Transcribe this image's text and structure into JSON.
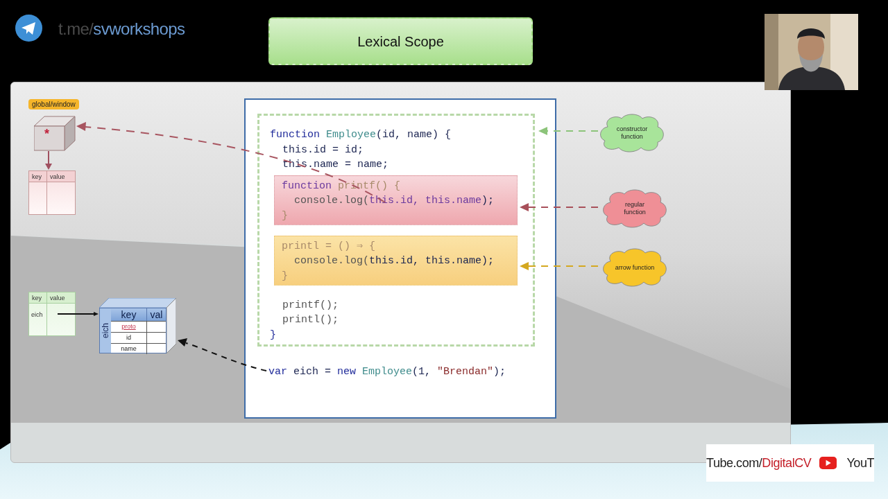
{
  "channel_link": {
    "prefix": "t.me/",
    "handle": "svworkshops"
  },
  "title": "Lexical Scope",
  "global_object": {
    "label": "global/window",
    "symbol": "*",
    "headers": [
      "key",
      "value"
    ]
  },
  "variable_table": {
    "headers": [
      "key",
      "value"
    ],
    "rows": [
      {
        "key": "eich"
      }
    ]
  },
  "object_table": {
    "name": "eich",
    "headers": [
      "key",
      "val"
    ],
    "keys": [
      "proto",
      "id",
      "name"
    ]
  },
  "code": {
    "constructor_lines": [
      [
        {
          "text": "function ",
          "kind": "keyword"
        },
        {
          "text": "Employee",
          "kind": "type"
        },
        {
          "text": "(id, name) {",
          "kind": "plain"
        }
      ],
      [
        {
          "text": "  this.id = id;",
          "kind": "plain"
        }
      ],
      [
        {
          "text": "  this.name = name;",
          "kind": "plain"
        }
      ]
    ],
    "regular_block": [
      [
        {
          "text": "function ",
          "kind": "purple"
        },
        {
          "text": "printf() {",
          "kind": "muted"
        }
      ],
      [
        {
          "text": "  console.log(",
          "kind": "call"
        },
        {
          "text": "this.id, this.name",
          "kind": "purple"
        },
        {
          "text": ");",
          "kind": "plain"
        }
      ],
      [
        {
          "text": "}",
          "kind": "muted"
        }
      ]
    ],
    "arrow_block": [
      [
        {
          "text": "printl = () ⇒ {",
          "kind": "muted"
        }
      ],
      [
        {
          "text": "  console.log(",
          "kind": "call"
        },
        {
          "text": "this.id, this.name);",
          "kind": "plain"
        }
      ],
      [
        {
          "text": "}",
          "kind": "muted"
        }
      ]
    ],
    "tail_lines": [
      [
        {
          "text": "  printf();",
          "kind": "call"
        }
      ],
      [
        {
          "text": "  printl();",
          "kind": "call"
        }
      ],
      [
        {
          "text": "}",
          "kind": "keyword"
        }
      ]
    ],
    "instantiation": [
      {
        "text": "var ",
        "kind": "keyword"
      },
      {
        "text": "eich = ",
        "kind": "plain"
      },
      {
        "text": "new ",
        "kind": "keyword"
      },
      {
        "text": "Employee",
        "kind": "type"
      },
      {
        "text": "(1, ",
        "kind": "plain"
      },
      {
        "text": "\"Brendan\"",
        "kind": "string"
      },
      {
        "text": ");",
        "kind": "plain"
      }
    ]
  },
  "callouts": [
    {
      "text": "constructor function",
      "color": "#a8e49a"
    },
    {
      "text": "regular function",
      "color": "#ef8f96"
    },
    {
      "text": "arrow function",
      "color": "#f7c52a"
    }
  ],
  "youtube_banner": {
    "prefix": "Tube.com/",
    "handle": "DigitalCV",
    "tail": "YouT"
  }
}
